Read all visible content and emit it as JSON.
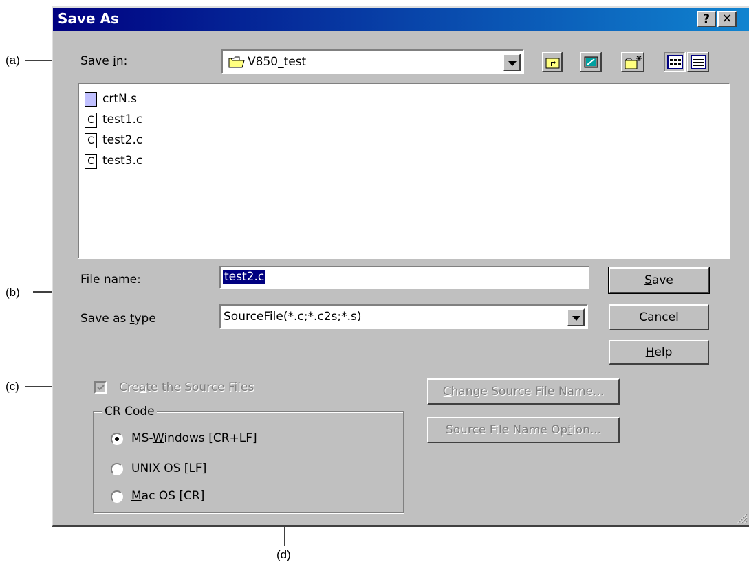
{
  "window": {
    "title": "Save As",
    "help_button": "?",
    "close_button": "✕"
  },
  "save_in": {
    "label_pre": "Save ",
    "label_u": "i",
    "label_post": "n:",
    "value": "V850_test"
  },
  "files": [
    {
      "name": "crtN.s",
      "icon": "asm-file-icon"
    },
    {
      "name": "test1.c",
      "icon": "c-file-icon"
    },
    {
      "name": "test2.c",
      "icon": "c-file-icon"
    },
    {
      "name": "test3.c",
      "icon": "c-file-icon"
    }
  ],
  "file_name": {
    "label_pre": "File ",
    "label_u": "n",
    "label_post": "ame:",
    "value": "test2.c"
  },
  "save_as_type": {
    "label_pre": "Save as ",
    "label_u": "t",
    "label_post": "ype",
    "value": "SourceFile(*.c;*.c2s;*.s)"
  },
  "buttons": {
    "save_u": "S",
    "save_rest": "ave",
    "cancel": "Cancel",
    "help_u": "H",
    "help_rest": "elp",
    "change_source_u": "C",
    "change_source_rest": "hange Source File Name...",
    "source_option_pre": "Source File Name Op",
    "source_option_u": "t",
    "source_option_post": "ion..."
  },
  "create_source": {
    "label_pre": "Cre",
    "label_u": "a",
    "label_post": "te the Source Files",
    "checked": true,
    "enabled": false
  },
  "cr_code": {
    "legend_pre": "C",
    "legend_u": "R",
    "legend_post": " Code",
    "options": [
      {
        "pre": "MS-",
        "u": "W",
        "post": "indows [CR+LF]",
        "selected": true
      },
      {
        "pre": "",
        "u": "U",
        "post": "NIX OS [LF]",
        "selected": false
      },
      {
        "pre": "",
        "u": "M",
        "post": "ac OS [CR]",
        "selected": false
      }
    ]
  },
  "annotations": {
    "a": "(a)",
    "b": "(b)",
    "c": "(c)",
    "d": "(d)"
  },
  "colors": {
    "title_start": "#000080",
    "title_end": "#1084d0",
    "face": "#c0c0c0",
    "selection": "#000080"
  }
}
